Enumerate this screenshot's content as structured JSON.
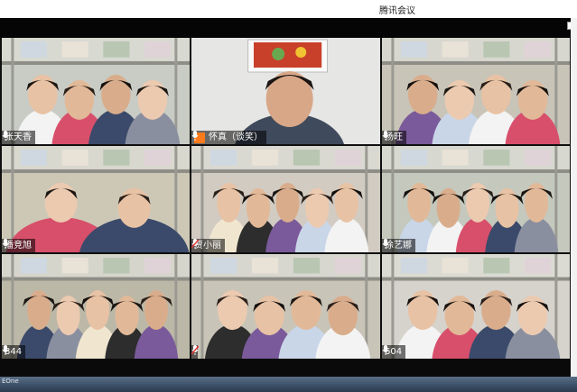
{
  "window": {
    "title": "腾讯会议"
  },
  "desktop": {
    "corner_text": "EOne"
  },
  "participants": [
    {
      "name": "张天香",
      "muted": false,
      "host": false,
      "scene": "dorm",
      "bg": "#c9ccc4"
    },
    {
      "name": "怀真（谈笑）",
      "muted": false,
      "host": true,
      "scene": "office",
      "bg": "#e4e4e2"
    },
    {
      "name": "杨旺",
      "muted": false,
      "host": false,
      "scene": "dorm",
      "bg": "#c8c4b8"
    },
    {
      "name": "潘竞旭",
      "muted": false,
      "host": false,
      "scene": "dorm",
      "bg": "#cdc8b6"
    },
    {
      "name": "贾小丽",
      "muted": true,
      "host": false,
      "scene": "dorm",
      "bg": "#d2cbc2"
    },
    {
      "name": "徐艺娜",
      "muted": false,
      "host": false,
      "scene": "dorm",
      "bg": "#c4c8bd"
    },
    {
      "name": "844",
      "muted": false,
      "host": false,
      "scene": "dorm",
      "bg": "#bcb8a8"
    },
    {
      "name": "",
      "muted": true,
      "host": false,
      "scene": "dorm",
      "bg": "#c9c4b8"
    },
    {
      "name": "604",
      "muted": false,
      "host": false,
      "scene": "dorm",
      "bg": "#d6d2cc"
    }
  ],
  "colors": {
    "host_badge": "#ff7a1a",
    "label_bg": "#000000",
    "muted_icon": "#e53935"
  },
  "icons": {
    "mic": "mic-icon",
    "muted": "mic-muted-icon",
    "host": "host-icon"
  }
}
